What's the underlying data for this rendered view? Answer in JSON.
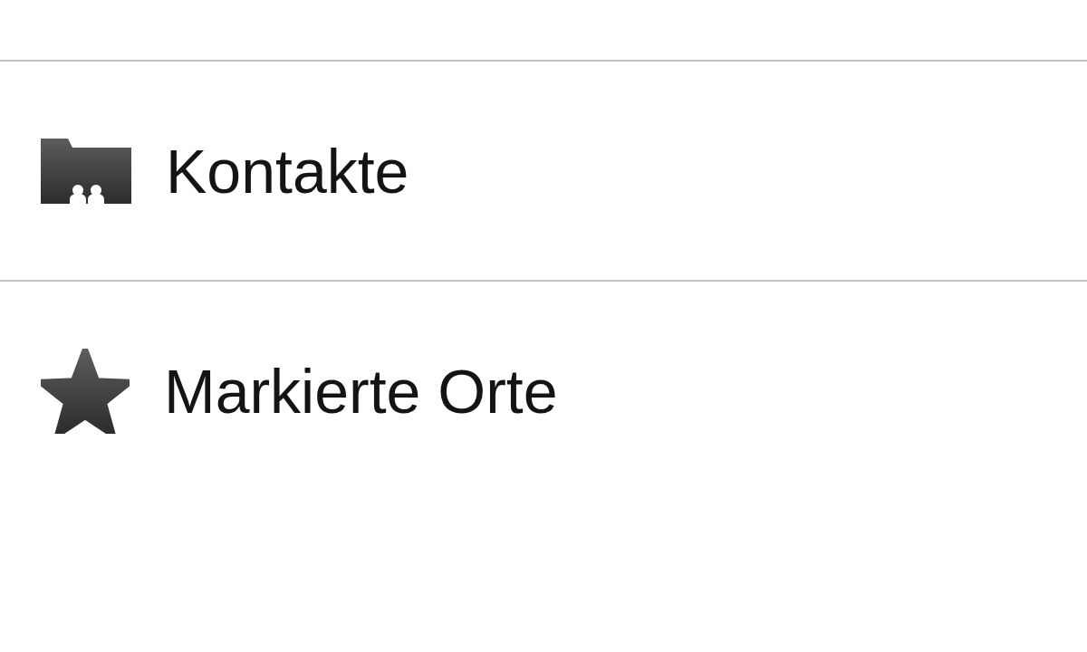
{
  "menu": {
    "items": [
      {
        "kind": "contacts",
        "label": "Kontakte"
      },
      {
        "kind": "starred",
        "label": "Markierte Orte"
      }
    ]
  }
}
